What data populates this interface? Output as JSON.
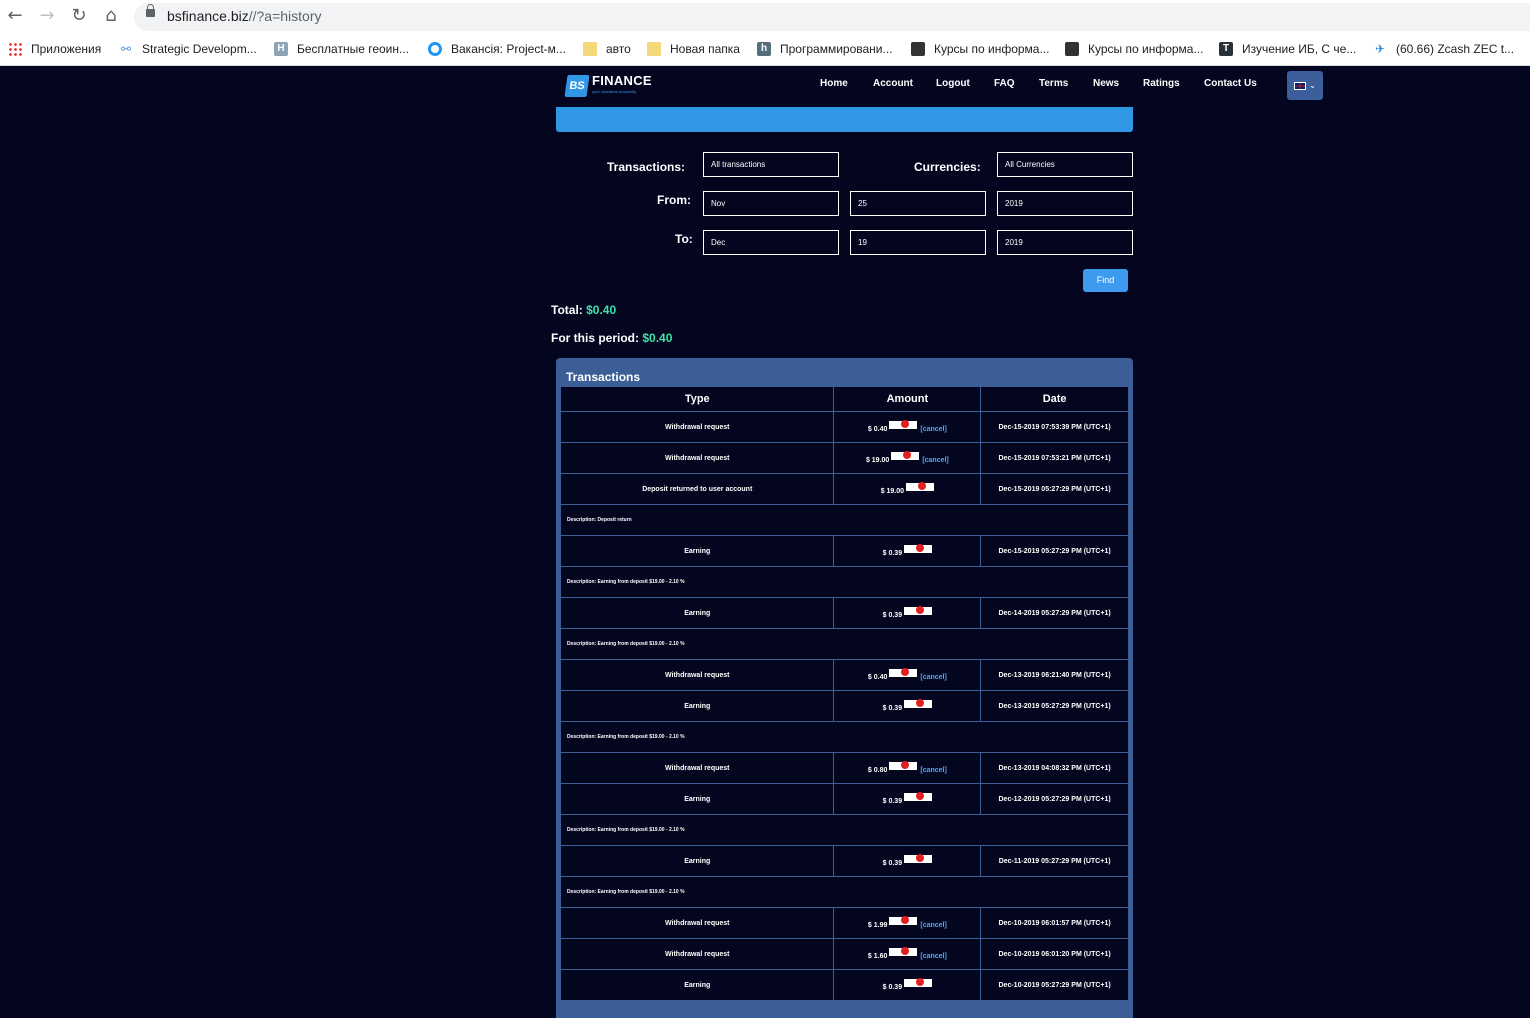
{
  "browser": {
    "url_host": "bsfinance.biz",
    "url_path": "//?a=history",
    "bookmarks": [
      {
        "label": "Приложения",
        "icon": "apps-grid-icon"
      },
      {
        "label": "Strategic Developm...",
        "icon": "link-icon"
      },
      {
        "label": "Бесплатные геоин...",
        "icon": "h-site-icon"
      },
      {
        "label": "Вакансія: Project-м...",
        "icon": "ring-icon"
      },
      {
        "label": "авто",
        "icon": "folder-icon"
      },
      {
        "label": "Новая папка",
        "icon": "folder-icon"
      },
      {
        "label": "Программировани...",
        "icon": "h-site-icon"
      },
      {
        "label": "Курсы по информа...",
        "icon": "hacker-icon"
      },
      {
        "label": "Курсы по информа...",
        "icon": "hacker-icon"
      },
      {
        "label": "Изучение ИБ, С че...",
        "icon": "t-site-icon"
      },
      {
        "label": "(60.66) Zcash ZEC t...",
        "icon": "plane-icon"
      }
    ]
  },
  "site": {
    "logo_mark": "BS",
    "logo_title": "FINANCE",
    "logo_subtitle": "your cloudless prosperity",
    "menu": [
      "Home",
      "Account",
      "Logout",
      "FAQ",
      "Terms",
      "News",
      "Ratings",
      "Contact Us"
    ]
  },
  "filter": {
    "transactions_label": "Transactions:",
    "transactions_value": "All transactions",
    "currencies_label": "Currencies:",
    "currencies_value": "All Currencies",
    "from_label": "From:",
    "from_month": "Nov",
    "from_day": "25",
    "from_year": "2019",
    "to_label": "To:",
    "to_month": "Dec",
    "to_day": "19",
    "to_year": "2019",
    "find_label": "Find"
  },
  "totals": {
    "total_label": "Total:",
    "total_value": "$0.40",
    "period_label": "For this period:",
    "period_value": "$0.40"
  },
  "transactions": {
    "title": "Transactions",
    "headers": [
      "Type",
      "Amount",
      "Date"
    ],
    "cancel_label": "[cancel]",
    "rows": [
      {
        "kind": "tx",
        "type": "Withdrawal request",
        "amount": "$ 0.40",
        "cancel": true,
        "date": "Dec-15-2019 07:53:39 PM (UTC+1)"
      },
      {
        "kind": "tx",
        "type": "Withdrawal request",
        "amount": "$ 19.00",
        "cancel": true,
        "date": "Dec-15-2019 07:53:21 PM (UTC+1)"
      },
      {
        "kind": "tx",
        "type": "Deposit returned to user account",
        "amount": "$ 19.00",
        "cancel": false,
        "date": "Dec-15-2019 05:27:29 PM (UTC+1)"
      },
      {
        "kind": "desc",
        "text": "Description: Deposit return"
      },
      {
        "kind": "tx",
        "type": "Earning",
        "amount": "$ 0.39",
        "cancel": false,
        "date": "Dec-15-2019 05:27:29 PM (UTC+1)"
      },
      {
        "kind": "desc",
        "text": "Description: Earning from deposit $19.00 - 2.10 %"
      },
      {
        "kind": "tx",
        "type": "Earning",
        "amount": "$ 0.39",
        "cancel": false,
        "date": "Dec-14-2019 05:27:29 PM (UTC+1)"
      },
      {
        "kind": "desc",
        "text": "Description: Earning from deposit $19.00 - 2.10 %"
      },
      {
        "kind": "tx",
        "type": "Withdrawal request",
        "amount": "$ 0.40",
        "cancel": true,
        "date": "Dec-13-2019 06:21:40 PM (UTC+1)"
      },
      {
        "kind": "tx",
        "type": "Earning",
        "amount": "$ 0.39",
        "cancel": false,
        "date": "Dec-13-2019 05:27:29 PM (UTC+1)"
      },
      {
        "kind": "desc",
        "text": "Description: Earning from deposit $19.00 - 2.10 %"
      },
      {
        "kind": "tx",
        "type": "Withdrawal request",
        "amount": "$ 0.80",
        "cancel": true,
        "date": "Dec-13-2019 04:08:32 PM (UTC+1)"
      },
      {
        "kind": "tx",
        "type": "Earning",
        "amount": "$ 0.39",
        "cancel": false,
        "date": "Dec-12-2019 05:27:29 PM (UTC+1)"
      },
      {
        "kind": "desc",
        "text": "Description: Earning from deposit $19.00 - 2.10 %"
      },
      {
        "kind": "tx",
        "type": "Earning",
        "amount": "$ 0.39",
        "cancel": false,
        "date": "Dec-11-2019 05:27:29 PM (UTC+1)"
      },
      {
        "kind": "desc",
        "text": "Description: Earning from deposit $19.00 - 2.10 %"
      },
      {
        "kind": "tx",
        "type": "Withdrawal request",
        "amount": "$ 1.99",
        "cancel": true,
        "date": "Dec-10-2019 06:01:57 PM (UTC+1)"
      },
      {
        "kind": "tx",
        "type": "Withdrawal request",
        "amount": "$ 1.60",
        "cancel": true,
        "date": "Dec-10-2019 06:01:20 PM (UTC+1)"
      },
      {
        "kind": "tx",
        "type": "Earning",
        "amount": "$ 0.39",
        "cancel": false,
        "date": "Dec-10-2019 05:27:29 PM (UTC+1)"
      }
    ]
  }
}
